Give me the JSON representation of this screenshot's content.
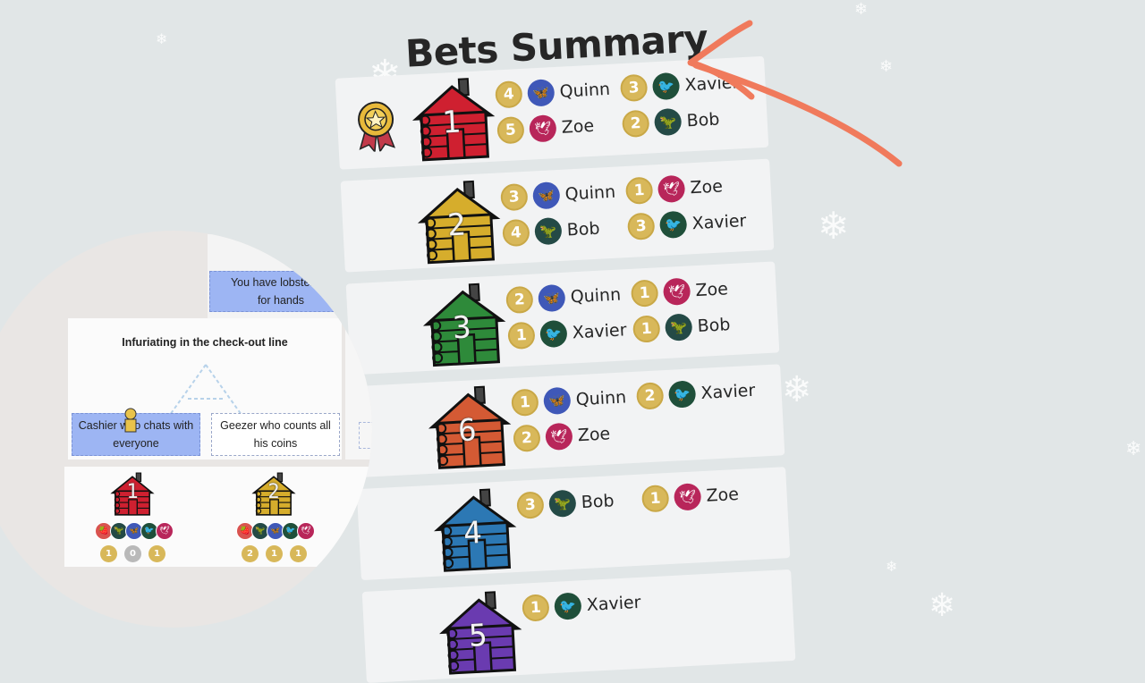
{
  "title": "Bets Summary",
  "colors": {
    "background": "#e1e6e7",
    "coin": "#d8b85a",
    "arrow": "#f07a5c",
    "quinn": "#3f58b8",
    "zoe": "#b8265a",
    "xavier": "#1f4f3a",
    "bob": "#244a46"
  },
  "rows": [
    {
      "house": "1",
      "house_color": "#cf2030",
      "winner": true,
      "bets": [
        {
          "amount": "4",
          "player": "Quinn",
          "icon": "butterfly-icon"
        },
        {
          "amount": "3",
          "player": "Xavier",
          "icon": "bird-icon"
        },
        {
          "amount": "5",
          "player": "Zoe",
          "icon": "dove-icon"
        },
        {
          "amount": "2",
          "player": "Bob",
          "icon": "dino-icon"
        }
      ]
    },
    {
      "house": "2",
      "house_color": "#d6ad2c",
      "winner": false,
      "bets": [
        {
          "amount": "3",
          "player": "Quinn",
          "icon": "butterfly-icon"
        },
        {
          "amount": "1",
          "player": "Zoe",
          "icon": "dove-icon"
        },
        {
          "amount": "4",
          "player": "Bob",
          "icon": "dino-icon"
        },
        {
          "amount": "3",
          "player": "Xavier",
          "icon": "bird-icon"
        }
      ]
    },
    {
      "house": "3",
      "house_color": "#2e8a3a",
      "winner": false,
      "bets": [
        {
          "amount": "2",
          "player": "Quinn",
          "icon": "butterfly-icon"
        },
        {
          "amount": "1",
          "player": "Zoe",
          "icon": "dove-icon"
        },
        {
          "amount": "1",
          "player": "Xavier",
          "icon": "bird-icon"
        },
        {
          "amount": "1",
          "player": "Bob",
          "icon": "dino-icon"
        }
      ]
    },
    {
      "house": "6",
      "house_color": "#d45a34",
      "winner": false,
      "bets": [
        {
          "amount": "1",
          "player": "Quinn",
          "icon": "butterfly-icon"
        },
        {
          "amount": "2",
          "player": "Xavier",
          "icon": "bird-icon"
        },
        {
          "amount": "2",
          "player": "Zoe",
          "icon": "dove-icon"
        }
      ]
    },
    {
      "house": "4",
      "house_color": "#2c78b4",
      "winner": false,
      "bets": [
        {
          "amount": "3",
          "player": "Bob",
          "icon": "dino-icon"
        },
        {
          "amount": "1",
          "player": "Zoe",
          "icon": "dove-icon"
        }
      ]
    },
    {
      "house": "5",
      "house_color": "#6a3bb0",
      "winner": false,
      "bets": [
        {
          "amount": "1",
          "player": "Xavier",
          "icon": "bird-icon"
        }
      ]
    }
  ],
  "lens": {
    "top_choice": "You have lobster cla\nfor hands",
    "prompt_title": "Infuriating in the check-out line",
    "choices": [
      "Cashier who chats with everyone",
      "Geezer who counts all his coins"
    ],
    "mini_houses": [
      {
        "house": "1",
        "house_color": "#cf2030",
        "coins": [
          "1",
          "0",
          "1"
        ]
      },
      {
        "house": "2",
        "house_color": "#d6ad2c",
        "coins": [
          "2",
          "1",
          "1"
        ]
      }
    ]
  }
}
